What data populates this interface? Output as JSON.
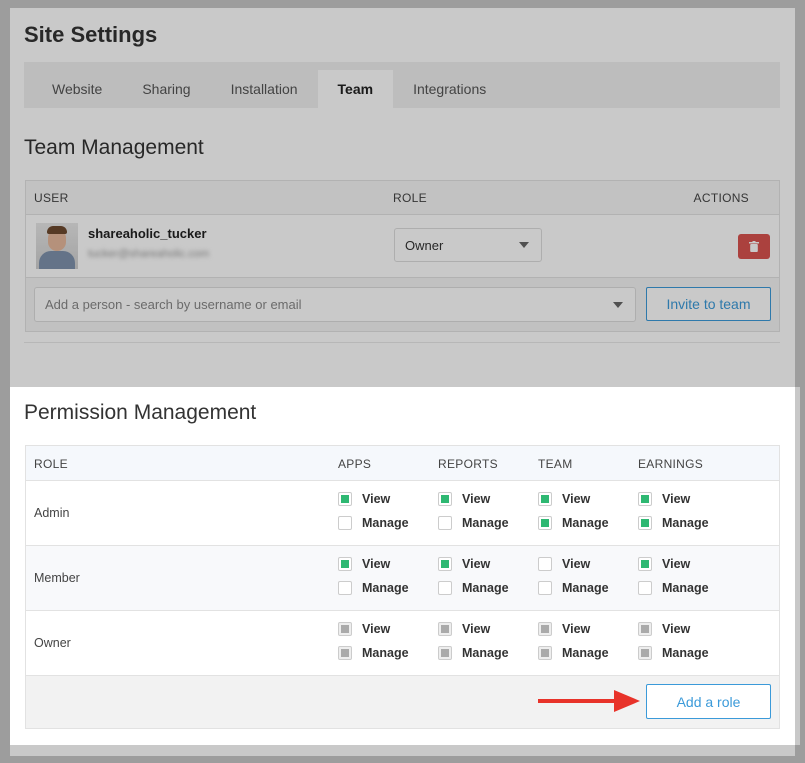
{
  "site_title": "Site Settings",
  "tabs": [
    {
      "label": "Website"
    },
    {
      "label": "Sharing"
    },
    {
      "label": "Installation"
    },
    {
      "label": "Team"
    },
    {
      "label": "Integrations"
    }
  ],
  "active_tab": "Team",
  "team": {
    "heading": "Team Management",
    "columns": {
      "user": "USER",
      "role": "ROLE",
      "actions": "ACTIONS"
    },
    "members": [
      {
        "username": "shareaholic_tucker",
        "email": "tucker@shareaholic.com",
        "role": "Owner"
      }
    ],
    "add_placeholder": "Add a person - search by username or email",
    "invite_label": "Invite to team"
  },
  "permissions": {
    "heading": "Permission Management",
    "columns": [
      "ROLE",
      "APPS",
      "REPORTS",
      "TEAM",
      "EARNINGS"
    ],
    "view_label": "View",
    "manage_label": "Manage",
    "rows": [
      {
        "role": "Admin",
        "perms": [
          [
            "on",
            "off"
          ],
          [
            "on",
            "off"
          ],
          [
            "on",
            "on"
          ],
          [
            "on",
            "on"
          ]
        ]
      },
      {
        "role": "Member",
        "perms": [
          [
            "on",
            "off"
          ],
          [
            "on",
            "off"
          ],
          [
            "off",
            "off"
          ],
          [
            "on",
            "off"
          ]
        ]
      },
      {
        "role": "Owner",
        "perms": [
          [
            "disabled",
            "disabled"
          ],
          [
            "disabled",
            "disabled"
          ],
          [
            "disabled",
            "disabled"
          ],
          [
            "disabled",
            "disabled"
          ]
        ]
      }
    ],
    "add_role_label": "Add a role"
  },
  "colors": {
    "accent": "#3b9ad9",
    "danger": "#d9534f",
    "checked": "#2eb872",
    "arrow": "#e8332a"
  }
}
